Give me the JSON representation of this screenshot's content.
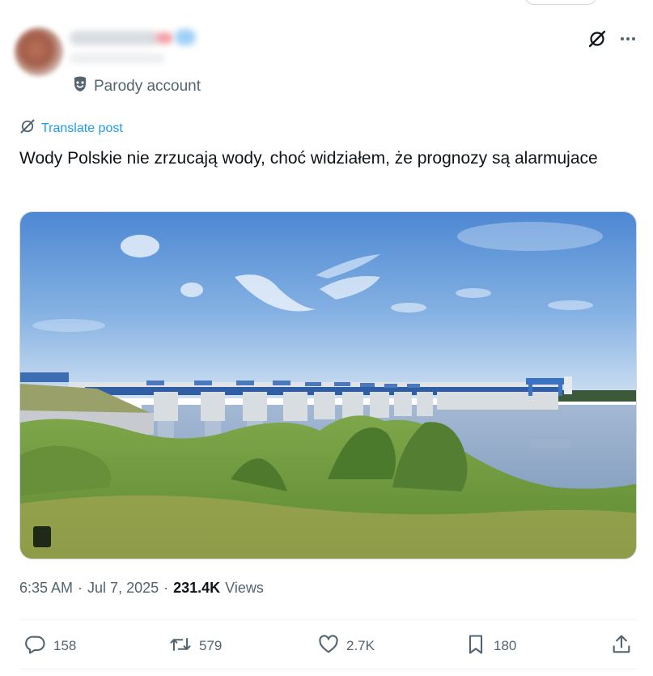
{
  "post": {
    "parody_label": "Parody account",
    "translate_label": "Translate post",
    "text": "Wody Polskie nie zrzucają wody, choć widziałem, że prognozy są alarmujace",
    "time": "6:35 AM",
    "separator": "·",
    "date": "Jul 7, 2025",
    "views_count": "231.4K",
    "views_label": "Views"
  },
  "actions": {
    "replies": "158",
    "reposts": "579",
    "likes": "2.7K",
    "bookmarks": "180"
  },
  "icons": {
    "header": [
      "grok-icon",
      "more-icon"
    ],
    "parody": "mask-icon",
    "translate": "grok-icon",
    "actions": [
      "reply-icon",
      "repost-icon",
      "like-icon",
      "bookmark-icon",
      "share-icon"
    ]
  },
  "colors": {
    "accent": "#1d9bf0",
    "muted_text": "#536471",
    "text": "#0f1419"
  }
}
